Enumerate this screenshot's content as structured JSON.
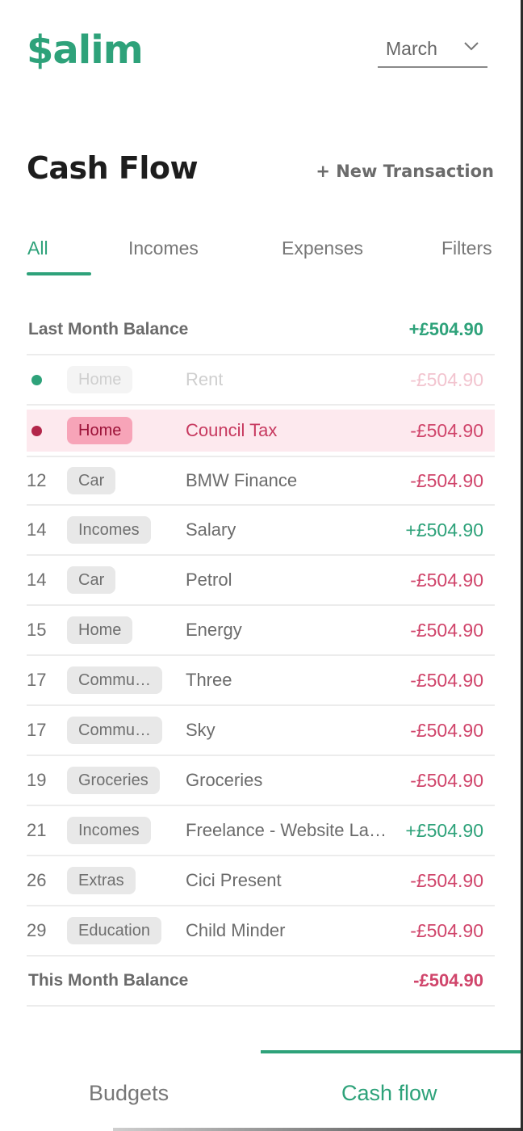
{
  "app": {
    "logo": "$alim"
  },
  "month_select": {
    "value": "March"
  },
  "header": {
    "title": "Cash Flow",
    "new_transaction": "+ New Transaction"
  },
  "tabs": [
    {
      "label": "All",
      "active": true
    },
    {
      "label": "Incomes",
      "active": false
    },
    {
      "label": "Expenses",
      "active": false
    },
    {
      "label": "Filters",
      "active": false
    }
  ],
  "last_month_balance": {
    "label": "Last Month Balance",
    "amount": "+£504.90"
  },
  "transactions": [
    {
      "day": "",
      "dot": "#2ea27a",
      "tag": "Home",
      "desc": "Rent",
      "amount": "-£504.90",
      "type": "neg",
      "state": "faded"
    },
    {
      "day": "",
      "dot": "#b3264a",
      "tag": "Home",
      "desc": "Council Tax",
      "amount": "-£504.90",
      "type": "neg",
      "state": "highlight"
    },
    {
      "day": "12",
      "tag": "Car",
      "desc": "BMW Finance",
      "amount": "-£504.90",
      "type": "neg"
    },
    {
      "day": "14",
      "tag": "Incomes",
      "desc": "Salary",
      "amount": "+£504.90",
      "type": "pos"
    },
    {
      "day": "14",
      "tag": "Car",
      "desc": "Petrol",
      "amount": "-£504.90",
      "type": "neg"
    },
    {
      "day": "15",
      "tag": "Home",
      "desc": "Energy",
      "amount": "-£504.90",
      "type": "neg"
    },
    {
      "day": "17",
      "tag": "Commu…",
      "desc": "Three",
      "amount": "-£504.90",
      "type": "neg"
    },
    {
      "day": "17",
      "tag": "Commu…",
      "desc": "Sky",
      "amount": "-£504.90",
      "type": "neg"
    },
    {
      "day": "19",
      "tag": "Groceries",
      "desc": "Groceries",
      "amount": "-£504.90",
      "type": "neg"
    },
    {
      "day": "21",
      "tag": "Incomes",
      "desc": "Freelance - Website La…",
      "amount": "+£504.90",
      "type": "pos"
    },
    {
      "day": "26",
      "tag": "Extras",
      "desc": "Cici Present",
      "amount": "-£504.90",
      "type": "neg"
    },
    {
      "day": "29",
      "tag": "Education",
      "desc": "Child Minder",
      "amount": "-£504.90",
      "type": "neg"
    }
  ],
  "this_month_balance": {
    "label": "This Month Balance",
    "amount": "-£504.90"
  },
  "bottom_nav": [
    {
      "label": "Budgets",
      "active": false
    },
    {
      "label": "Cash flow",
      "active": true
    }
  ],
  "colors": {
    "accent": "#2ea27a",
    "negative": "#d0456b",
    "highlight_bg": "#fde9ee"
  }
}
